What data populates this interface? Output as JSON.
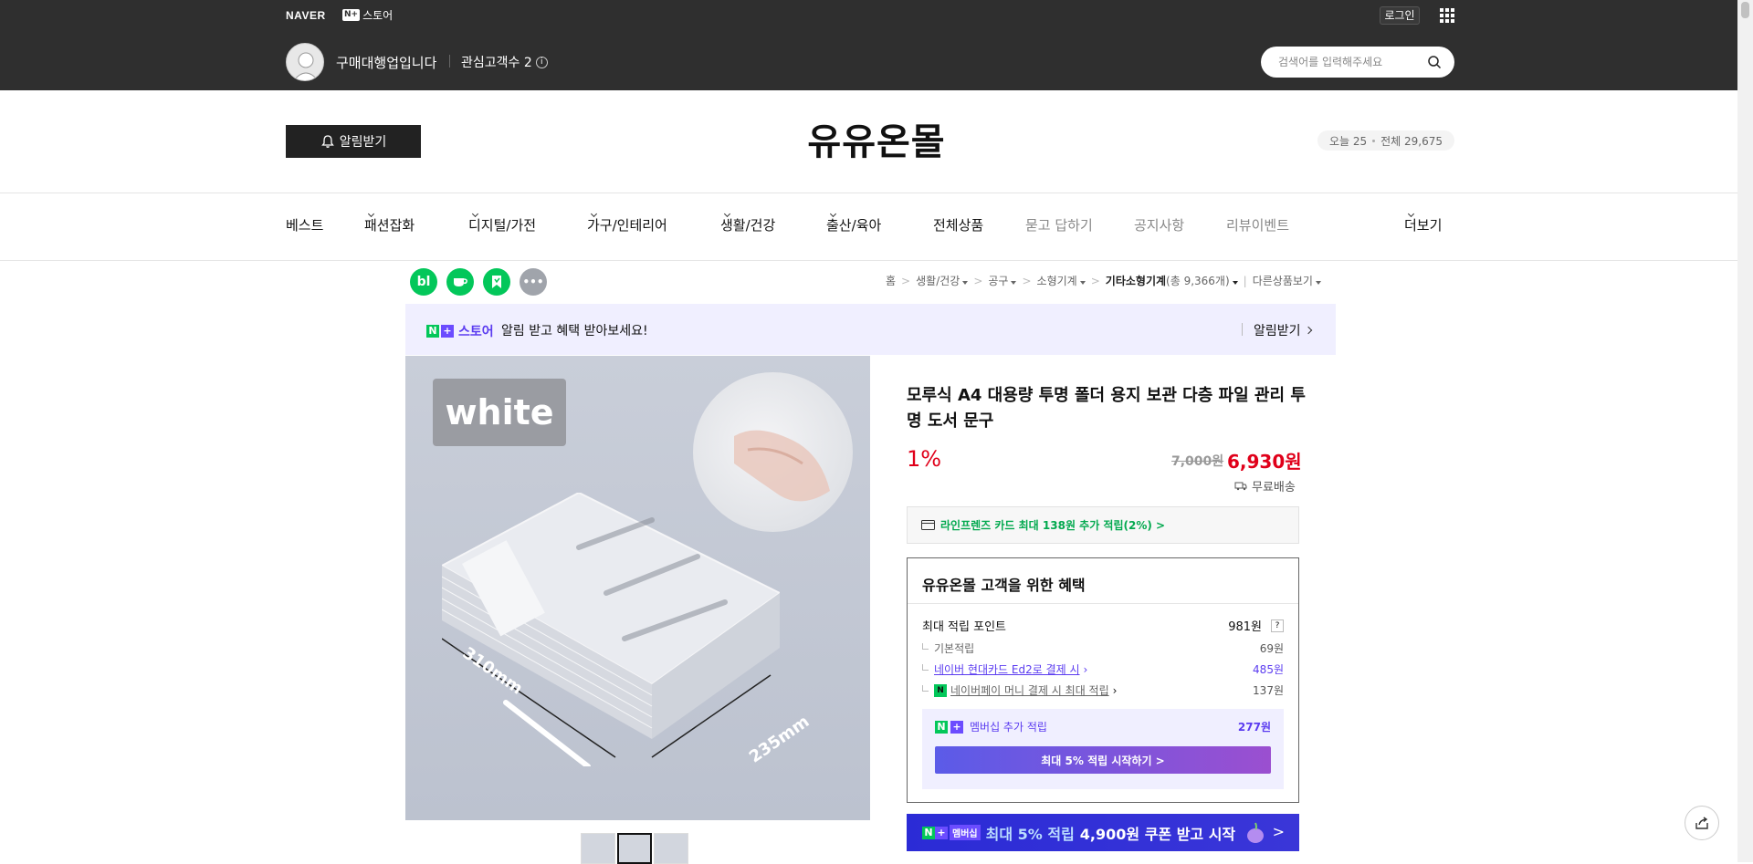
{
  "topbar": {
    "brand": "NAVER",
    "nplus_box": "N+",
    "store_label": "스토어",
    "login_label": "로그인",
    "store_name": "구매대행업입니다",
    "interest_label": "관심고객수 2",
    "info_icon": "ⓘ",
    "search_placeholder": "검색어를 입력해주세요"
  },
  "header": {
    "alarm_label": "알림받기",
    "store_title": "유유온몰",
    "today_label": "오늘 25",
    "total_label": "전체 29,675"
  },
  "nav": {
    "items": [
      "베스트",
      "패션잡화",
      "디지털/가전",
      "가구/인테리어",
      "생활/건강",
      "출산/육아",
      "전체상품",
      "묻고 답하기",
      "공지사항",
      "리뷰이벤트",
      "더보기"
    ]
  },
  "social": {
    "icons": [
      "blog-icon",
      "cafe-icon",
      "bookmark-icon",
      "more-icon"
    ],
    "blog_text": "bl",
    "colors": {
      "green": "#03c75a",
      "gray": "#a0a4ab"
    }
  },
  "breadcrumb": {
    "home": "홈",
    "c1": "생활/건강",
    "c2": "공구",
    "c3": "소형기계",
    "c4": "기타소형기계",
    "c4_count": "(총 9,366개)",
    "other": "다른상품보기"
  },
  "notice": {
    "n": "N",
    "plus": "+",
    "store": "스토어",
    "message": "알림 받고 혜택 받아보세요!",
    "button": "알림받기"
  },
  "product": {
    "image_label": "white",
    "dim1": "310mm",
    "dim2": "235mm",
    "name": "모루식 A4 대용량 투명 폴더 용지 보관 다층 파일 관리 투명 도서 문구",
    "discount": "1%",
    "original_price": "7,000원",
    "price": "6,930원",
    "shipping": "무료배송",
    "card_benefit": "라인프렌즈 카드 최대 138원 추가 적립(2%) >"
  },
  "benefit": {
    "title": "유유온몰 고객을 위한 혜택",
    "max_label": "최대 적립 포인트",
    "max_value": "981원",
    "qmark": "?",
    "basic_label": "기본적립",
    "basic_value": "69원",
    "card_label": "네이버 현대카드 Ed2로 결제 시",
    "card_value": "485원",
    "pay_label": "네이버페이 머니 결제 시 최대 적립",
    "pay_value": "137원",
    "npay_mark": "N",
    "member_label": "멤버십 추가 적립",
    "member_value": "277원",
    "member_button": "최대 5% 적립 시작하기 >"
  },
  "banner": {
    "tag": "멤버십",
    "text1": "최대 5% 적립",
    "text2": "4,900원 쿠폰 받고 시작",
    "arrow": ">"
  },
  "colors": {
    "topbar": "#2f2f2f",
    "accent_purple": "#5b3cf0",
    "price_red": "#e0001a",
    "naver_green": "#03c75a"
  }
}
